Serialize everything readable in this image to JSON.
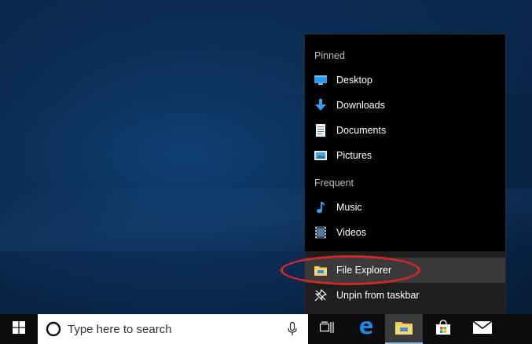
{
  "jumplist": {
    "pinned_header": "Pinned",
    "pinned": [
      {
        "label": "Desktop",
        "icon": "desktop-icon"
      },
      {
        "label": "Downloads",
        "icon": "downloads-icon"
      },
      {
        "label": "Documents",
        "icon": "documents-icon"
      },
      {
        "label": "Pictures",
        "icon": "pictures-icon"
      }
    ],
    "frequent_header": "Frequent",
    "frequent": [
      {
        "label": "Music",
        "icon": "music-icon"
      },
      {
        "label": "Videos",
        "icon": "videos-icon"
      }
    ],
    "app_item": {
      "label": "File Explorer",
      "icon": "file-explorer-icon"
    },
    "unpin_item": {
      "label": "Unpin from taskbar",
      "icon": "unpin-icon"
    }
  },
  "taskbar": {
    "search_placeholder": "Type here to search"
  },
  "colors": {
    "accent": "#80b8e6",
    "highlight_oval": "#d7262b",
    "edge_blue": "#1e88e5",
    "folder_yellow": "#f2c94c"
  }
}
